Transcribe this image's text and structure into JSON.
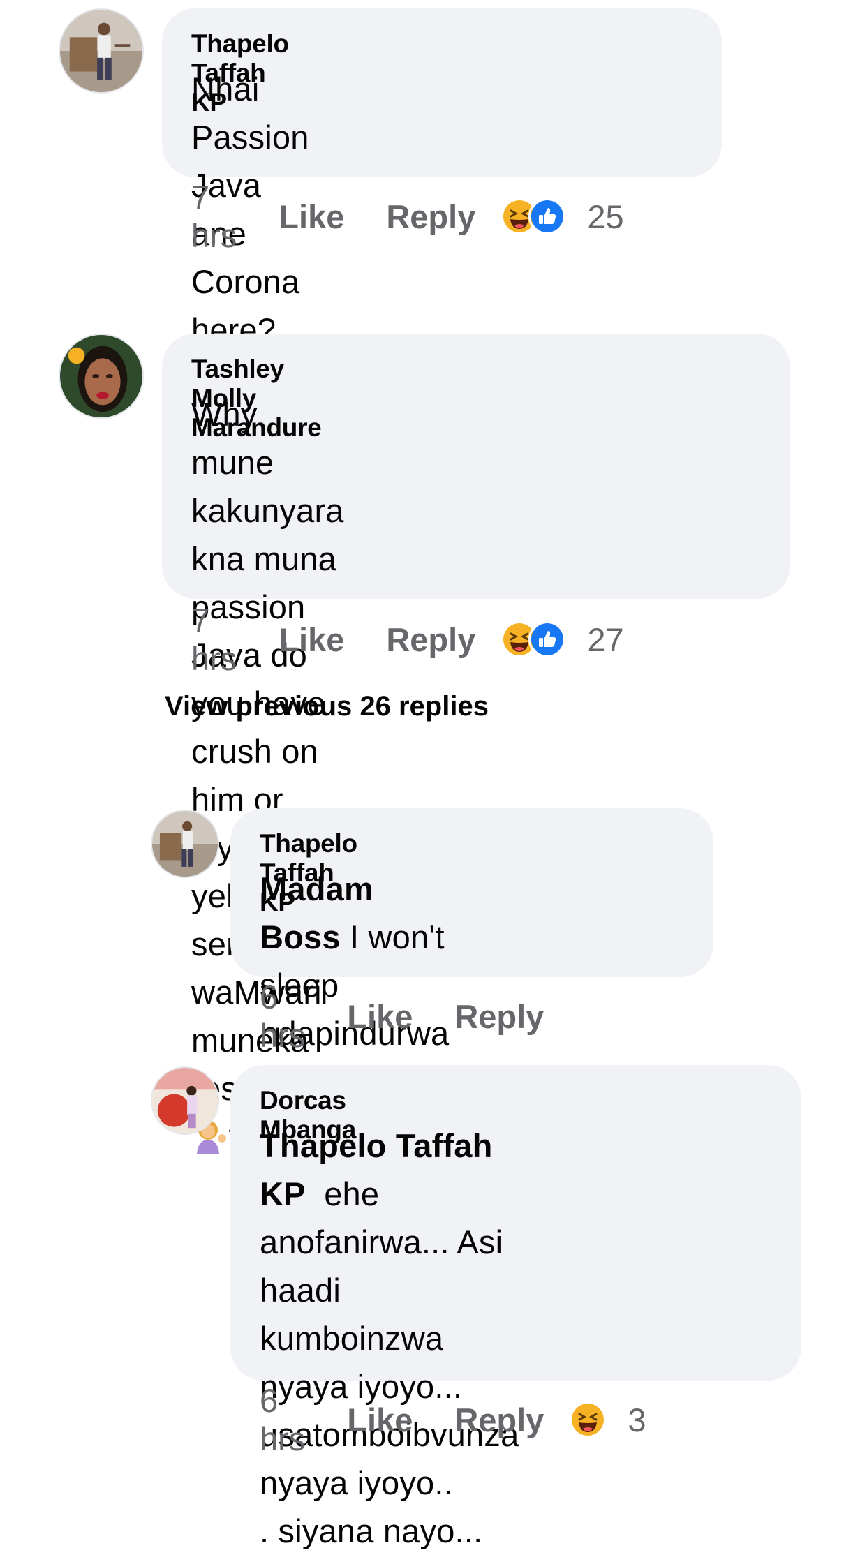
{
  "comments": [
    {
      "author": "Thapelo Taffah KP",
      "text_lines": [
        "Nhai Passion Java ane Corona",
        "here?"
      ],
      "time": "7 hrs",
      "like_label": "Like",
      "reply_label": "Reply",
      "reaction_icons": [
        "haha-icon",
        "like-icon"
      ],
      "reaction_count": "25"
    },
    {
      "author": "Tashley Molly Marandure",
      "text_lines": [
        "Why mune kakunyara kna muna",
        "passion Java do you have crush on",
        "him or inyaya yekyt semunhu",
        "waMwari muneka respect",
        "??"
      ],
      "time": "7 hrs",
      "like_label": "Like",
      "reply_label": "Reply",
      "reaction_icons": [
        "haha-icon",
        "like-icon"
      ],
      "reaction_count": "27"
    }
  ],
  "view_previous": "View previous 26 replies",
  "replies": [
    {
      "author": "Thapelo Taffah KP",
      "mention": "Madam Boss",
      "text_lines": [
        " I won't sleep",
        "ndapindurwa nemi"
      ],
      "time": "6 hrs",
      "like_label": "Like",
      "reply_label": "Reply"
    },
    {
      "author": "Dorcas Mbanga",
      "mention": "Thapelo Taffah KP",
      "text_lines": [
        "  ehe",
        "anofanirwa... Asi haadi",
        "kumboinzwa nyaya iyoyo...",
        "usatomboibvunza nyaya iyoyo..",
        ". siyana nayo..."
      ],
      "time": "6 hrs",
      "like_label": "Like",
      "reply_label": "Reply",
      "reaction_icons": [
        "haha-icon"
      ],
      "reaction_count": "3"
    }
  ],
  "colors": {
    "bubble": "#f0f2f5",
    "meta_text": "#65676b",
    "haha": "#f7b125",
    "like": "#1877f2"
  }
}
